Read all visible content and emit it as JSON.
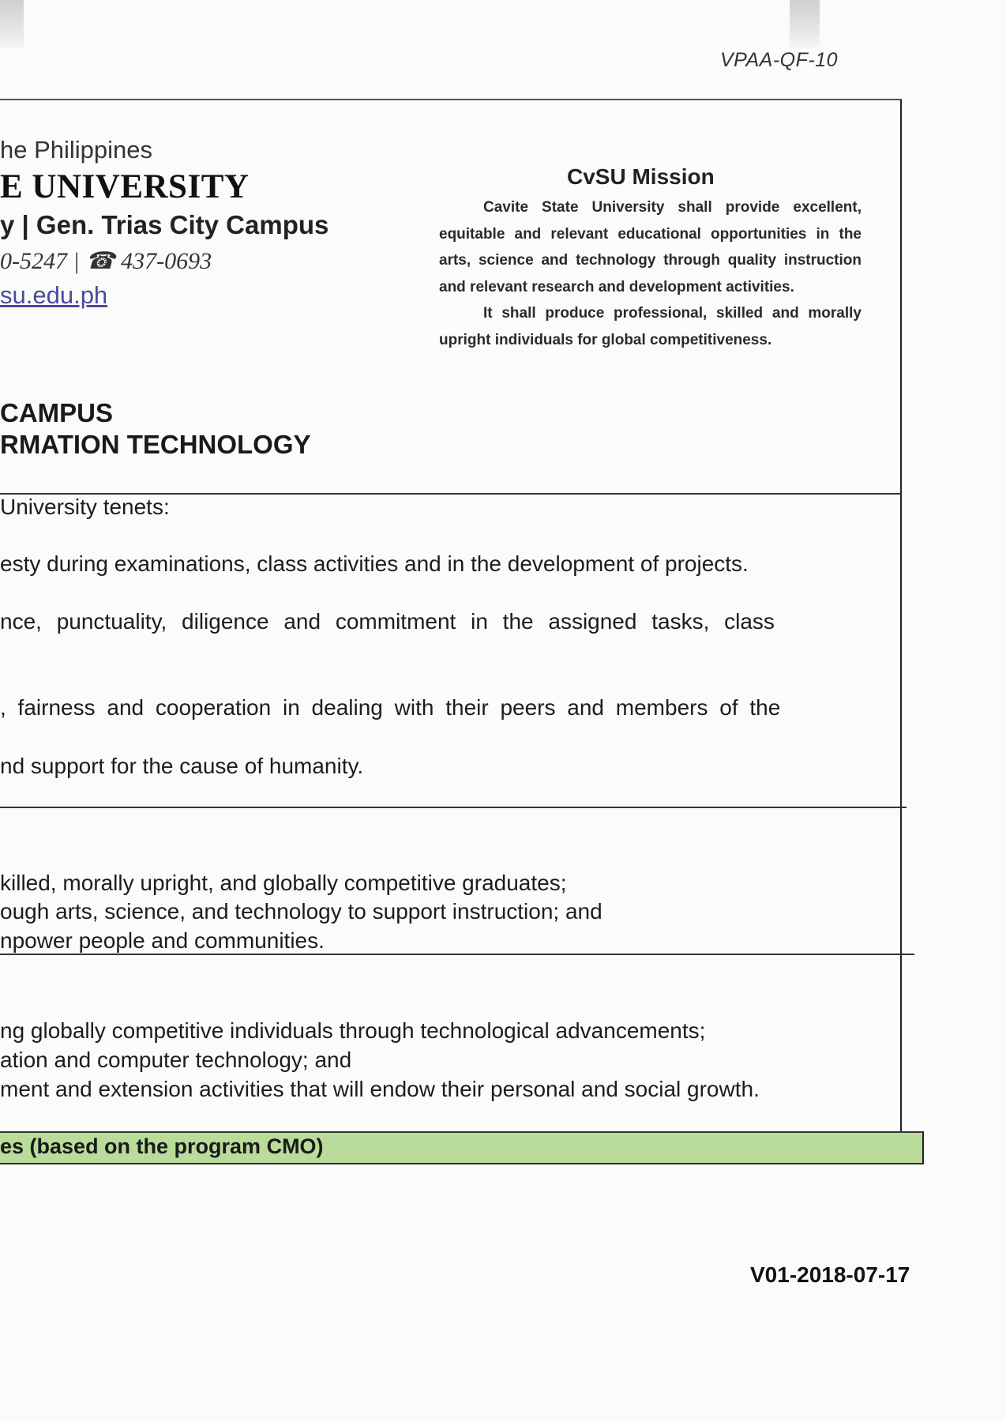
{
  "form_code": "VPAA-QF-10",
  "header": {
    "country": "he Philippines",
    "university": "E UNIVERSITY",
    "campus": "y | Gen. Trias City Campus",
    "phone": "0-5247 | ☎ 437-0693",
    "email": "su.edu.ph",
    "campus_label": "CAMPUS",
    "department": "RMATION TECHNOLOGY"
  },
  "mission": {
    "title": "CvSU Mission",
    "paragraphs": [
      "Cavite State University shall provide excellent, equitable and relevant educational opportunities in the arts, science and technology through quality instruction and relevant research and development activities.",
      "It shall produce professional, skilled and morally upright individuals for global competitiveness."
    ]
  },
  "tenets": {
    "intro": "University tenets:",
    "items": [
      "esty during examinations, class activities and in the development of projects.",
      "nce, punctuality, diligence and commitment in the assigned tasks, class",
      ", fairness and cooperation in dealing with their peers and members of the",
      "nd support for the cause of humanity."
    ]
  },
  "goals": [
    "killed, morally upright, and globally competitive graduates;",
    "ough arts, science, and technology to support instruction; and",
    "npower people and communities."
  ],
  "objectives": [
    "ng globally competitive individuals through technological advancements;",
    "ation and computer technology; and",
    "ment and extension activities that will endow their personal and social growth."
  ],
  "outcomes_header": "es (based on the program CMO)",
  "version": "V01-2018-07-17"
}
